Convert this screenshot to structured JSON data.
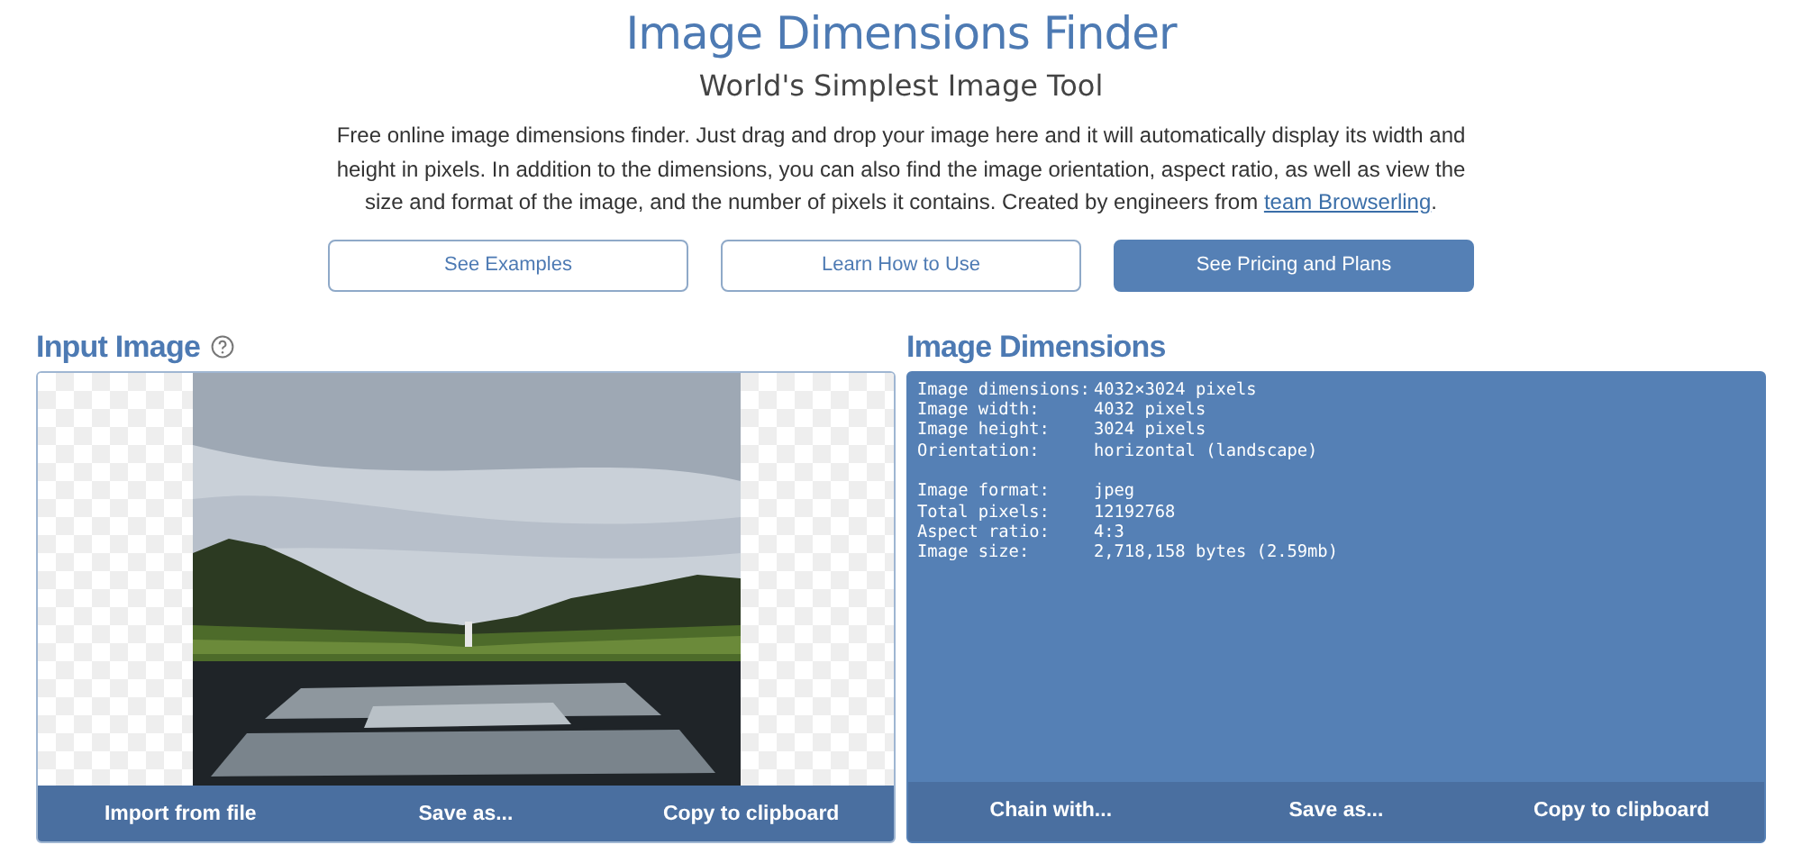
{
  "header": {
    "title": "Image Dimensions Finder",
    "subtitle": "World's Simplest Image Tool",
    "description": "Free online image dimensions finder. Just drag and drop your image here and it will automatically display its width and height in pixels. In addition to the dimensions, you can also find the image orientation, aspect ratio, as well as view the size and format of the image, and the number of pixels it contains. Created by engineers from",
    "link": "team Browserling",
    "after_link": "."
  },
  "buttons": [
    {
      "label": "See Examples",
      "kind": "outline"
    },
    {
      "label": "Learn How to Use",
      "kind": "outline"
    },
    {
      "label": "See Pricing and Plans",
      "kind": "filled"
    }
  ],
  "input_panel": {
    "title": "Input Image",
    "image": {
      "kind": "picture"
    },
    "actions": [
      "Import from file",
      "Save as...",
      "Copy to clipboard"
    ]
  },
  "output_panel": {
    "title": "Image Dimensions",
    "groups": [
      [
        {
          "label": "Image dimensions:",
          "value": "4032×3024 pixels"
        },
        {
          "label": "Image width:",
          "value": "4032 pixels"
        },
        {
          "label": "Image height:",
          "value": "3024 pixels"
        },
        {
          "label": "Orientation:",
          "value": "horizontal (landscape)"
        }
      ],
      [
        {
          "label": "Image format:",
          "value": "jpeg"
        },
        {
          "label": "Total pixels:",
          "value": "12192768"
        },
        {
          "label": "Aspect ratio:",
          "value": "4:3"
        },
        {
          "label": "Image size:",
          "value": "2,718,158 bytes (2.59mb)"
        }
      ]
    ],
    "actions": [
      "Chain with...",
      "Save as...",
      "Copy to clipboard"
    ]
  }
}
